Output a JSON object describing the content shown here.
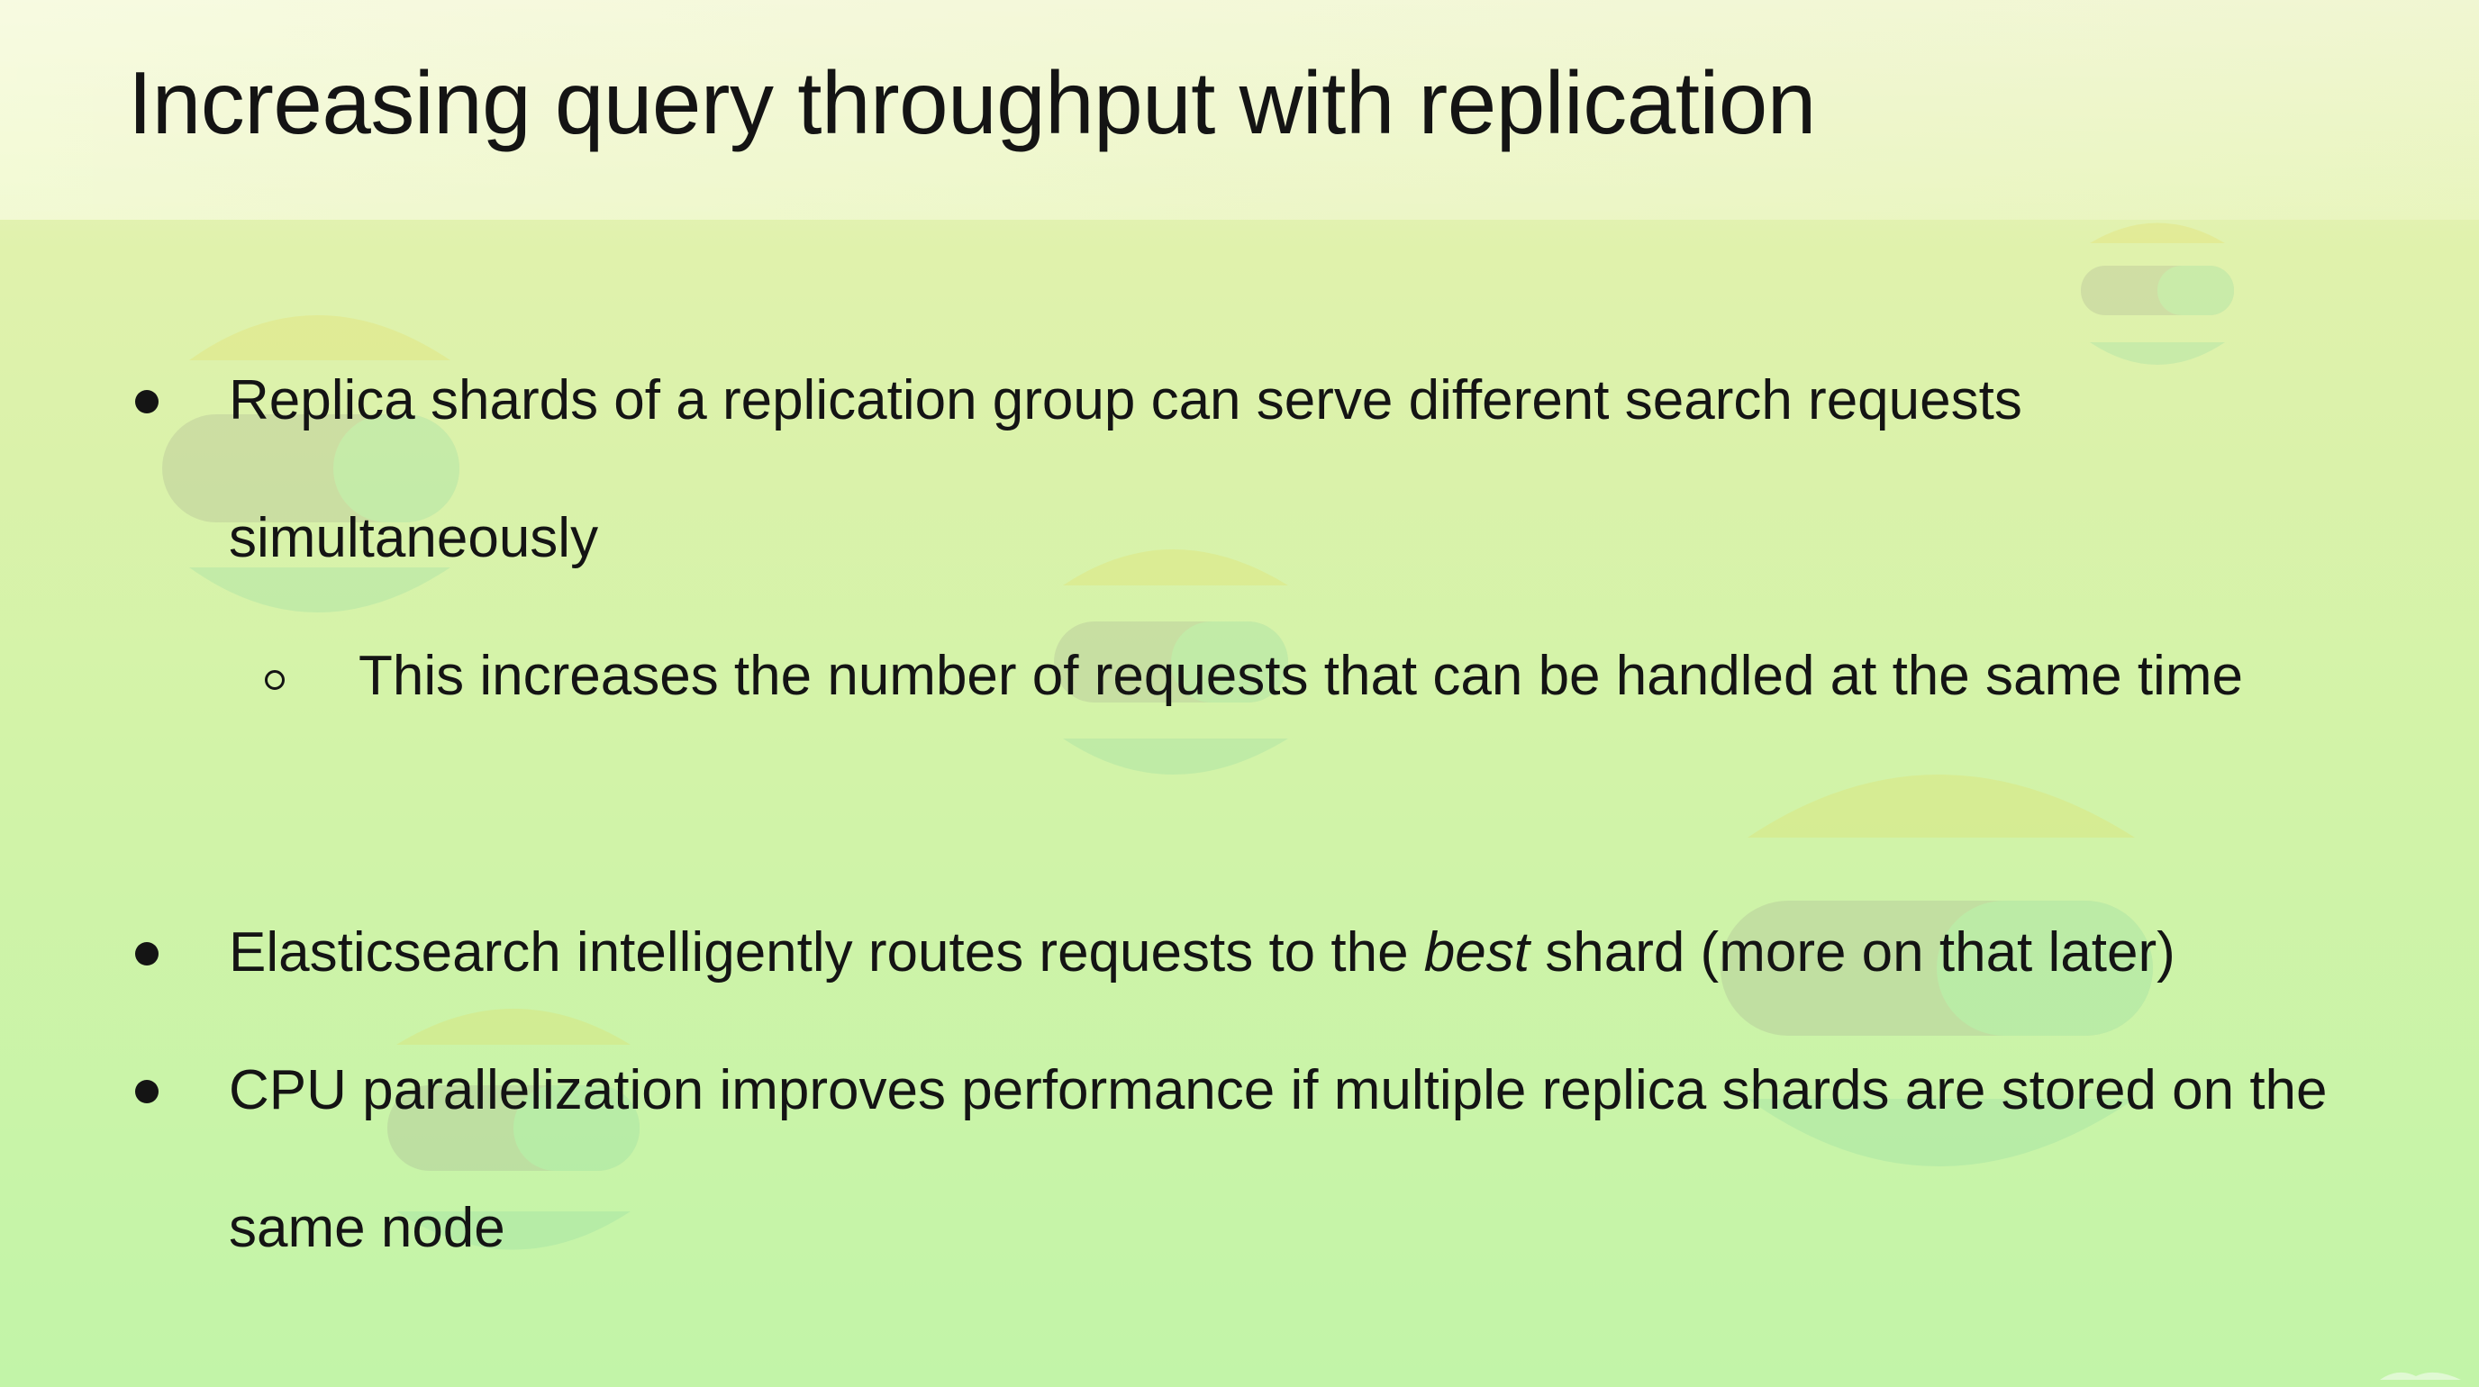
{
  "slide": {
    "title": "Increasing query throughput with replication",
    "bullets": [
      {
        "text": "Replica shards of a replication group can serve different search requests simultaneously",
        "sub_bullets": [
          {
            "text": "This increases the number of requests that can be handled at the same time"
          }
        ]
      },
      {
        "text_before": "Elasticsearch intelligently routes requests to the ",
        "text_emphasis": "best",
        "text_after": " shard (more on that later)"
      },
      {
        "text": "CPU parallelization improves performance if multiple replica shards are stored on the same node"
      }
    ]
  },
  "colors": {
    "background_top": "#eef4cf",
    "background_bottom": "#c2f4a8",
    "text": "#141414",
    "watermark_yellow": "#e9d64a",
    "watermark_green": "#7fd3a3",
    "watermark_gray": "#9a9a8a"
  },
  "icons": {
    "bullet_level_1": "filled-circle",
    "bullet_level_2": "hollow-circle",
    "watermark": "elastic-logo-watermark"
  }
}
